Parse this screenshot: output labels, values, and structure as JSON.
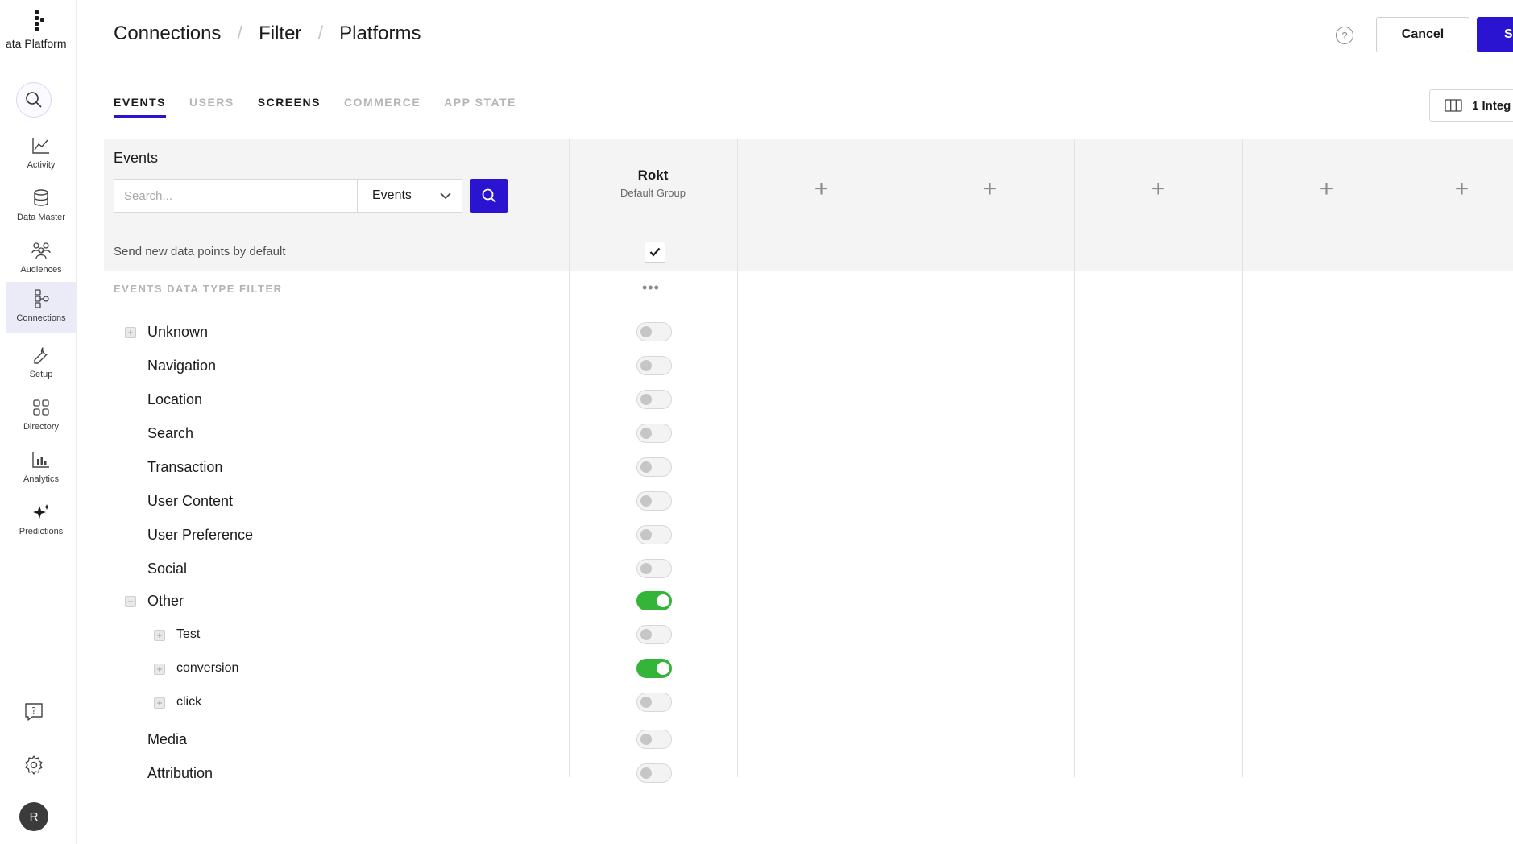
{
  "sidebar": {
    "brand": "ata Platform",
    "items": [
      {
        "label": "Activity",
        "icon": "activity-icon"
      },
      {
        "label": "Data Master",
        "icon": "database-icon"
      },
      {
        "label": "Audiences",
        "icon": "audiences-icon"
      },
      {
        "label": "Connections",
        "icon": "connections-icon",
        "active": true
      },
      {
        "label": "Setup",
        "icon": "wrench-icon"
      },
      {
        "label": "Directory",
        "icon": "grid-icon"
      },
      {
        "label": "Analytics",
        "icon": "analytics-icon"
      },
      {
        "label": "Predictions",
        "icon": "sparkle-icon"
      }
    ],
    "avatar_initial": "R"
  },
  "header": {
    "breadcrumb": [
      "Connections",
      "Filter",
      "Platforms"
    ],
    "breadcrumb_separator": "/",
    "help_glyph": "?",
    "cancel_label": "Cancel",
    "save_label": "S"
  },
  "tabs": [
    {
      "label": "EVENTS",
      "state": "active"
    },
    {
      "label": "USERS",
      "state": "muted"
    },
    {
      "label": "SCREENS",
      "state": "dark"
    },
    {
      "label": "COMMERCE",
      "state": "muted"
    },
    {
      "label": "APP STATE",
      "state": "muted"
    }
  ],
  "integrations_button": "1 Integ",
  "panel": {
    "title": "Events",
    "search_placeholder": "Search...",
    "type_select": "Events",
    "default_label": "Send new data points by default",
    "filter_label": "EVENTS DATA TYPE FILTER",
    "more_glyph": "•••"
  },
  "columns": [
    {
      "name": "Rokt",
      "group": "Default Group"
    }
  ],
  "add_column_glyph": "+",
  "events": [
    {
      "label": "Unknown",
      "level": 0,
      "expander": "+",
      "enabled": false
    },
    {
      "label": "Navigation",
      "level": 0,
      "expander": "",
      "enabled": false
    },
    {
      "label": "Location",
      "level": 0,
      "expander": "",
      "enabled": false
    },
    {
      "label": "Search",
      "level": 0,
      "expander": "",
      "enabled": false
    },
    {
      "label": "Transaction",
      "level": 0,
      "expander": "",
      "enabled": false
    },
    {
      "label": "User Content",
      "level": 0,
      "expander": "",
      "enabled": false
    },
    {
      "label": "User Preference",
      "level": 0,
      "expander": "",
      "enabled": false
    },
    {
      "label": "Social",
      "level": 0,
      "expander": "",
      "enabled": false
    },
    {
      "label": "Other",
      "level": 0,
      "expander": "−",
      "enabled": true
    },
    {
      "label": "Test",
      "level": 1,
      "expander": "+",
      "enabled": false
    },
    {
      "label": "conversion",
      "level": 1,
      "expander": "+",
      "enabled": true
    },
    {
      "label": "click",
      "level": 1,
      "expander": "+",
      "enabled": false
    },
    {
      "label": "Media",
      "level": 0,
      "expander": "",
      "enabled": false
    },
    {
      "label": "Attribution",
      "level": 0,
      "expander": "",
      "enabled": false
    }
  ],
  "colors": {
    "accent": "#2b14d1",
    "toggle_on": "#34b539",
    "active_nav_bg": "#ebeaf7"
  }
}
